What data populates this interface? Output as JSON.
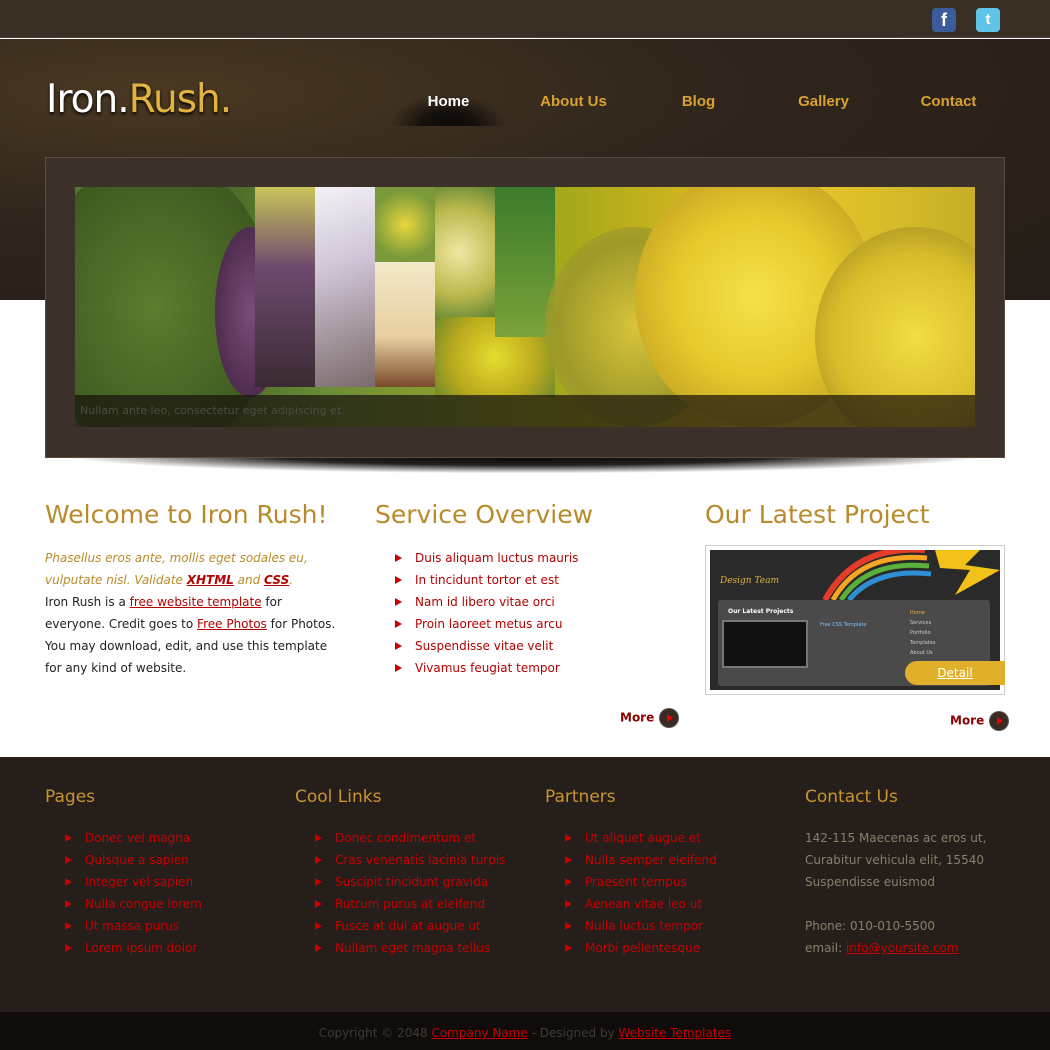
{
  "social": {
    "facebook_glyph": "f",
    "twitter_glyph": "t"
  },
  "logo": {
    "part1": "Iron.",
    "part2": "Rush."
  },
  "nav": [
    {
      "label": "Home"
    },
    {
      "label": "About Us"
    },
    {
      "label": "Blog"
    },
    {
      "label": "Gallery"
    },
    {
      "label": "Contact"
    }
  ],
  "slider": {
    "caption": "Nullam ante leo, consectetur eget adipiscing et."
  },
  "welcome": {
    "title": "Welcome to Iron Rush!",
    "intro_text": "Phasellus eros ante, mollis eget sodales eu, vulputate nisl. Validate",
    "xhtml_link": "XHTML",
    "and_text": "and",
    "css_link": "CSS",
    "period": ".",
    "body_start": "Iron Rush is a",
    "template_link": "free website template",
    "body_mid": "for everyone. Credit goes to",
    "photos_link": "Free Photos",
    "body_end": "for Photos. You may download, edit, and use this template for any kind of website."
  },
  "services": {
    "title": "Service Overview",
    "items": [
      "Duis aliquam luctus mauris",
      "In tincidunt tortor et est",
      "Nam id libero vitae orci",
      "Proin laoreet metus arcu",
      "Suspendisse vitae velit",
      "Vivamus feugiat tempor"
    ],
    "more_label": "More"
  },
  "project": {
    "title": "Our Latest Project",
    "design_team": "Design Team",
    "inner_heading": "Our Latest Projects",
    "inner_sub": "Free CSS Template",
    "inner_menu": [
      "Home",
      "Services",
      "Portfolio",
      "Templates",
      "About Us"
    ],
    "detail_label": "Detail",
    "more_label": "More"
  },
  "footer": {
    "pages": {
      "title": "Pages",
      "items": [
        "Donec vel magna",
        "Quisque a sapien",
        "Integer vel sapien",
        "Nulla congue lorem",
        "Ut massa purus",
        "Lorem ipsum dolor"
      ]
    },
    "cool_links": {
      "title": "Cool Links",
      "items": [
        "Donec condimentum et",
        "Cras venenatis lacinia turpis",
        "Suscipit tincidunt gravida",
        "Rutrum purus at eleifend",
        "Fusce at dui at augue ut",
        "Nullam eget magna tellus"
      ]
    },
    "partners": {
      "title": "Partners",
      "items": [
        "Ut aliquet augue et",
        "Nulla semper eleifend",
        "Praesent tempus",
        "Aenean vitae leo ut",
        "Nulla luctus tempor",
        "Morbi pellentesque"
      ]
    },
    "contact": {
      "title": "Contact Us",
      "address_lines": [
        "142-115 Maecenas ac eros ut,",
        "Curabitur vehicula elit, 15540",
        "Suspendisse euismod"
      ],
      "phone": "Phone: 010-010-5500",
      "email_label": "email:",
      "email": "info@yoursite.com"
    }
  },
  "copyright": {
    "text": "Copyright © 2048",
    "company_link": "Company Name",
    "designed_by": "- Designed by",
    "templates_link": "Website Templates"
  },
  "colors": {
    "header_bg": "#2f251c",
    "accent_gold": "#d9a230",
    "link_red": "#b40000",
    "footer_bg": "#251e1b"
  }
}
